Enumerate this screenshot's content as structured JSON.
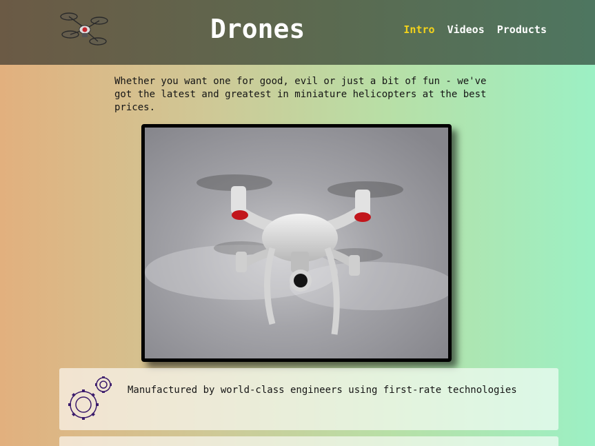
{
  "header": {
    "title": "Drones",
    "logo_icon": "drone-logo-icon",
    "nav": [
      {
        "label": "Intro",
        "active": true
      },
      {
        "label": "Videos",
        "active": false
      },
      {
        "label": "Products",
        "active": false
      }
    ],
    "active_color": "#f2d21b"
  },
  "intro": {
    "text": "Whether you want one for good, evil or just a bit of fun - we've got the latest and greatest in miniature helicopters at the best prices."
  },
  "hero": {
    "image_icon": "quadcopter-photo"
  },
  "features": [
    {
      "icon": "gears-icon",
      "text": "Manufactured by world-class engineers using first-rate technologies"
    }
  ]
}
